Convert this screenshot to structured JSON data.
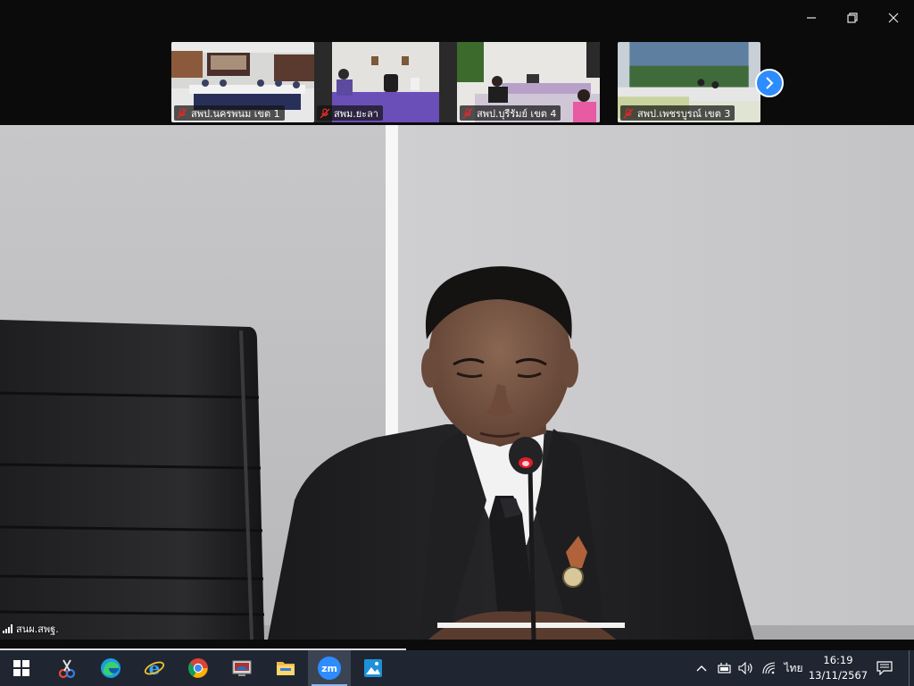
{
  "window": {
    "controls": [
      "minimize",
      "restore",
      "close"
    ]
  },
  "thumbnails": [
    {
      "label": "สพป.นครพนม เขต 1",
      "mic_muted": true
    },
    {
      "label": "สพม.ยะลา",
      "mic_muted": true
    },
    {
      "label": "สพป.บุรีรัมย์ เขต 4",
      "mic_muted": true
    },
    {
      "label": "สพป.เพชรบูรณ์ เขต 3",
      "mic_muted": true
    }
  ],
  "next_page_icon": "chevron-right-icon",
  "main_speaker": {
    "name": "สนผ.สพฐ.",
    "signal_icon": "signal-bars-icon"
  },
  "taskbar": {
    "apps": [
      {
        "name": "start",
        "icon": "windows-start-icon"
      },
      {
        "name": "snipping-tool",
        "icon": "snipping-tool-icon"
      },
      {
        "name": "edge",
        "icon": "edge-icon"
      },
      {
        "name": "internet-explorer",
        "icon": "internet-explorer-icon"
      },
      {
        "name": "chrome",
        "icon": "chrome-icon"
      },
      {
        "name": "remote-desktop",
        "icon": "remote-desktop-icon"
      },
      {
        "name": "file-explorer",
        "icon": "folder-icon"
      },
      {
        "name": "zoom",
        "icon": "zoom-icon",
        "text": "zm",
        "active": true
      },
      {
        "name": "photos",
        "icon": "photos-icon"
      }
    ],
    "tray": {
      "language": "ไทย",
      "time": "16:19",
      "date": "13/11/2567"
    }
  },
  "colors": {
    "zoom_blue": "#2d8cff",
    "taskbar": "#1f2631",
    "wall": "#c9c9cb"
  }
}
